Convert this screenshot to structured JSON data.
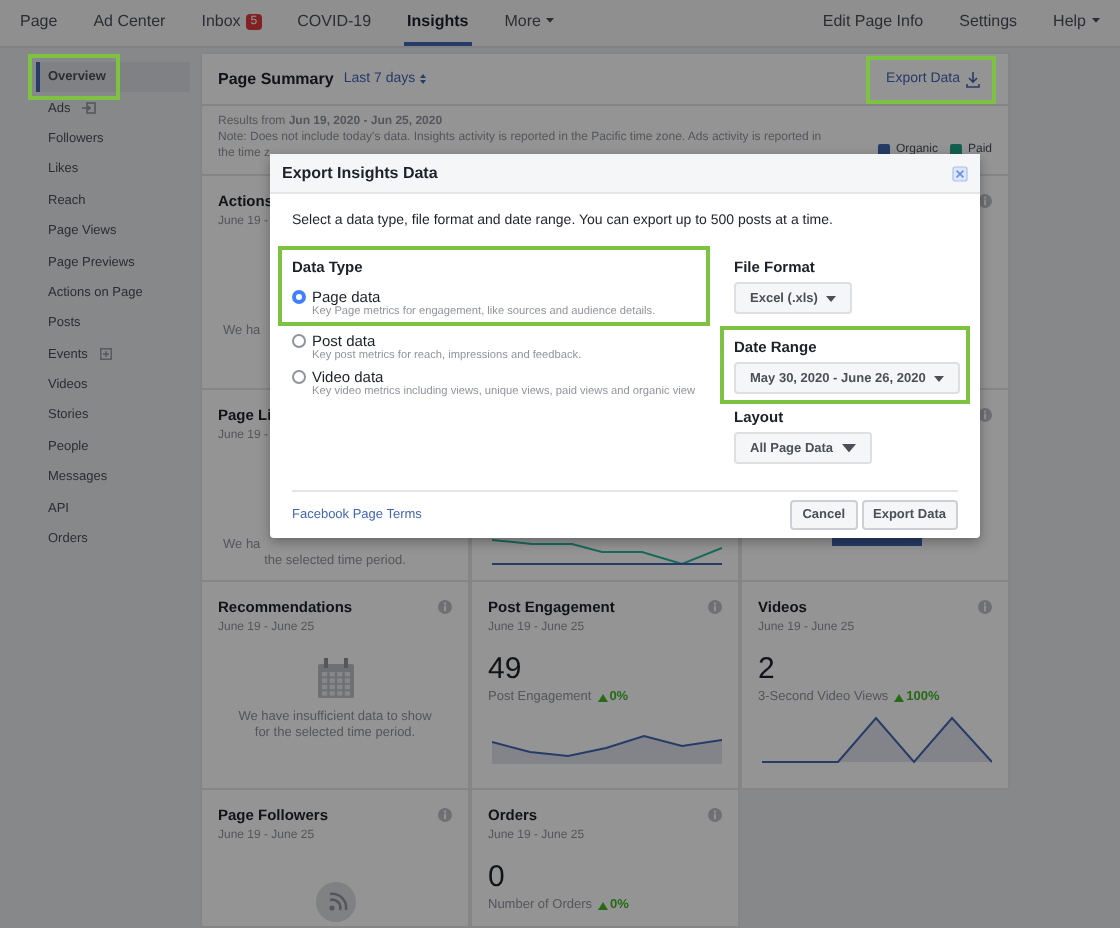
{
  "nav": {
    "left": [
      {
        "label": "Page",
        "selected": false
      },
      {
        "label": "Ad Center",
        "selected": false
      },
      {
        "label": "Inbox",
        "selected": false,
        "badge": "5"
      },
      {
        "label": "COVID-19",
        "selected": false
      },
      {
        "label": "Insights",
        "selected": true
      },
      {
        "label": "More",
        "selected": false,
        "menu": true
      }
    ],
    "right": [
      {
        "label": "Edit Page Info",
        "menu": false
      },
      {
        "label": "Settings",
        "menu": false
      },
      {
        "label": "Help",
        "menu": true
      }
    ]
  },
  "sidebar": {
    "items": [
      {
        "label": "Overview",
        "selected": true,
        "highlighted": true,
        "kind": "plain"
      },
      {
        "label": "Ads",
        "selected": false,
        "highlighted": false,
        "kind": "link_out"
      },
      {
        "label": "Followers",
        "selected": false,
        "highlighted": false,
        "kind": "plain"
      },
      {
        "label": "Likes",
        "selected": false,
        "highlighted": false,
        "kind": "plain"
      },
      {
        "label": "Reach",
        "selected": false,
        "highlighted": false,
        "kind": "plain"
      },
      {
        "label": "Page Views",
        "selected": false,
        "highlighted": false,
        "kind": "plain"
      },
      {
        "label": "Page Previews",
        "selected": false,
        "highlighted": false,
        "kind": "plain"
      },
      {
        "label": "Actions on Page",
        "selected": false,
        "highlighted": false,
        "kind": "plain"
      },
      {
        "label": "Posts",
        "selected": false,
        "highlighted": false,
        "kind": "plain"
      },
      {
        "label": "Events",
        "selected": false,
        "highlighted": false,
        "kind": "expand"
      },
      {
        "label": "Videos",
        "selected": false,
        "highlighted": false,
        "kind": "plain"
      },
      {
        "label": "Stories",
        "selected": false,
        "highlighted": false,
        "kind": "plain"
      },
      {
        "label": "People",
        "selected": false,
        "highlighted": false,
        "kind": "plain"
      },
      {
        "label": "Messages",
        "selected": false,
        "highlighted": false,
        "kind": "plain"
      },
      {
        "label": "API",
        "selected": false,
        "highlighted": false,
        "kind": "plain"
      },
      {
        "label": "Orders",
        "selected": false,
        "highlighted": false,
        "kind": "plain"
      }
    ]
  },
  "summary": {
    "title": "Page Summary",
    "period": "Last 7 days",
    "export": {
      "label": "Export Data",
      "highlighted": true
    },
    "results": "Results from **Jun 19, 2020 - Jun 25, 2020**",
    "note_lines": [
      "Note: Does not include today's data. Insights activity is reported in the Pacific time zone. Ads activity is reported in",
      "the time z"
    ],
    "legend": [
      {
        "label": "Organic",
        "color": "#263c67"
      },
      {
        "label": "Paid",
        "color": "#145f50"
      }
    ]
  },
  "cards": [
    {
      "kind": "clipped",
      "title": "Actions",
      "date": "June 19 -",
      "message_lines": [
        "We ha"
      ],
      "info": false
    },
    {
      "kind": "hidden",
      "info": true
    },
    {
      "kind": "clipped",
      "title": "Page Li",
      "date": "June 19 -",
      "message_lines": [
        "We ha",
        "the selected time period."
      ],
      "info": false
    },
    {
      "kind": "partial_lines",
      "info": false
    },
    {
      "kind": "partial_bar",
      "info": true
    },
    {
      "kind": "empty",
      "title": "Recommendations",
      "date": "June 19 - June 25",
      "message": "We have insufficient data to show for the selected time period.",
      "info": true
    },
    {
      "kind": "metric_wave",
      "title": "Post Engagement",
      "date": "June 19 - June 25",
      "value": "49",
      "metric": "Post Engagement",
      "change": "0%",
      "info": true
    },
    {
      "kind": "metric_peaks",
      "title": "Videos",
      "date": "June 19 - June 25",
      "value": "2",
      "metric": "3-Second Video Views",
      "change": "100%",
      "info": true
    },
    {
      "kind": "followers",
      "title": "Page Followers",
      "date": "June 19 - June 25",
      "info": true
    },
    {
      "kind": "metric",
      "title": "Orders",
      "date": "June 19 - June 25",
      "value": "0",
      "metric": "Number of Orders",
      "change": "0%",
      "info": true
    }
  ],
  "modal": {
    "title": "Export Insights Data",
    "intro": "Select a data type, file format and date range. You can export up to 500 posts at a time.",
    "data_type": {
      "label": "Data Type",
      "options": [
        {
          "label": "Page data",
          "description": "Key Page metrics for engagement, like sources and audience details.",
          "selected": true,
          "highlighted": true
        },
        {
          "label": "Post data",
          "description": "Key post metrics for reach, impressions and feedback.",
          "selected": false,
          "highlighted": false
        },
        {
          "label": "Video data",
          "description": "Key video metrics including views, unique views, paid views and organic view",
          "selected": false,
          "highlighted": false
        }
      ]
    },
    "file_format": {
      "label": "File Format",
      "value": "Excel (.xls)",
      "highlighted": false
    },
    "date_range": {
      "label": "Date Range",
      "value": "May 30, 2020 - June 26, 2020",
      "highlighted": true
    },
    "layout": {
      "label": "Layout",
      "value": "All Page Data",
      "highlighted": false
    },
    "terms": "Facebook Page Terms",
    "buttons": [
      "Cancel",
      "Export Data"
    ]
  }
}
